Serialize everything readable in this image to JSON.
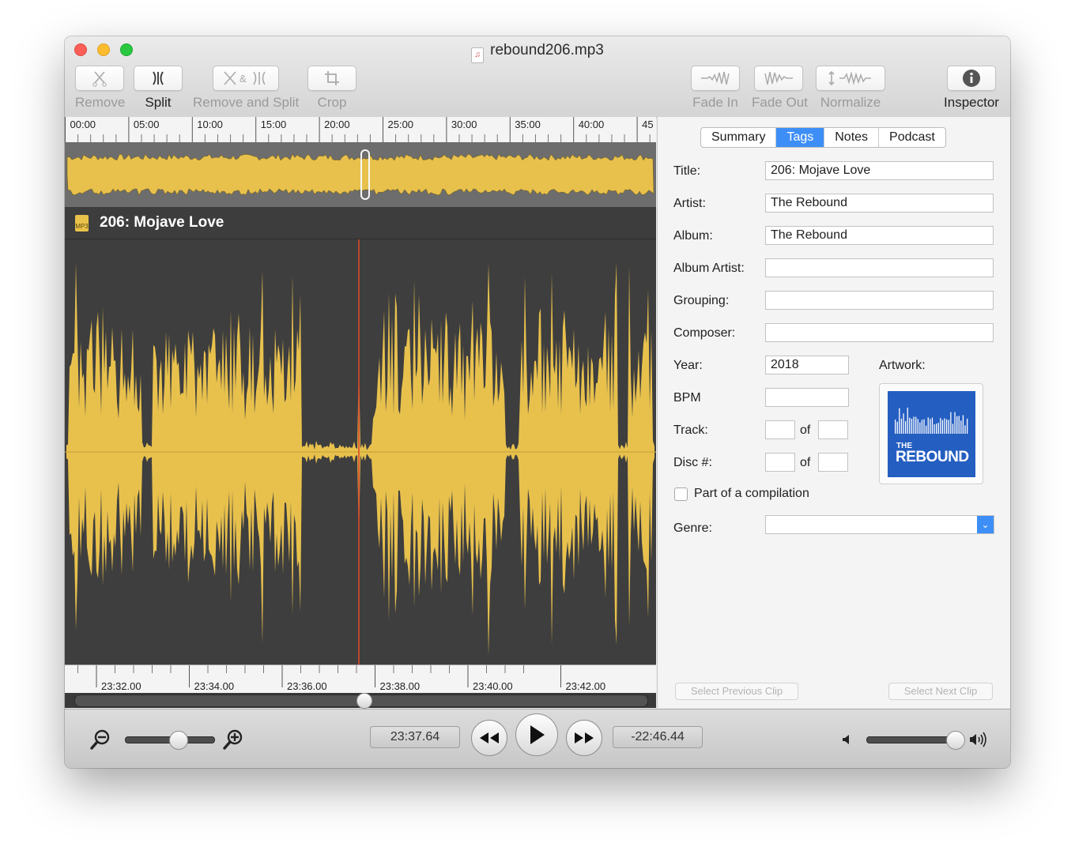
{
  "window": {
    "title": "rebound206.mp3"
  },
  "toolbar": {
    "remove": "Remove",
    "split": "Split",
    "remove_and_split": "Remove and Split",
    "crop": "Crop",
    "fade_in": "Fade In",
    "fade_out": "Fade Out",
    "normalize": "Normalize",
    "inspector": "Inspector"
  },
  "timeline": {
    "top_ticks": [
      "00:00",
      "05:00",
      "10:00",
      "15:00",
      "20:00",
      "25:00",
      "30:00",
      "35:00",
      "40:00",
      "45"
    ],
    "bottom_ticks": [
      "23:32.00",
      "23:34.00",
      "23:36.00",
      "23:38.00",
      "23:40.00",
      "23:42.00"
    ]
  },
  "clip": {
    "title": "206: Mojave Love",
    "icon": "mp3-file-icon",
    "icon_text": "MP3"
  },
  "inspector": {
    "tabs": [
      "Summary",
      "Tags",
      "Notes",
      "Podcast"
    ],
    "selected_tab": "Tags",
    "labels": {
      "title": "Title:",
      "artist": "Artist:",
      "album": "Album:",
      "album_artist": "Album Artist:",
      "grouping": "Grouping:",
      "composer": "Composer:",
      "year": "Year:",
      "bpm": "BPM",
      "track": "Track:",
      "disc": "Disc #:",
      "of": "of",
      "artwork": "Artwork:",
      "compilation": "Part of a compilation",
      "genre": "Genre:"
    },
    "values": {
      "title": "206: Mojave Love",
      "artist": "The Rebound",
      "album": "The Rebound",
      "album_artist": "",
      "grouping": "",
      "composer": "",
      "year": "2018",
      "bpm": "",
      "track": "",
      "track_of": "",
      "disc": "",
      "disc_of": "",
      "compilation": false,
      "genre": ""
    },
    "artwork": {
      "small_text": "THE",
      "big_text": "REBOUND"
    },
    "select_previous": "Select Previous Clip",
    "select_next": "Select Next Clip"
  },
  "transport": {
    "current_time": "23:37.64",
    "remaining_time": "-22:46.44",
    "zoom_level": 0.6,
    "volume_level": 0.95
  },
  "colors": {
    "waveform": "#e8c14d",
    "playhead": "#d9482b",
    "accent": "#3d8ff7"
  }
}
